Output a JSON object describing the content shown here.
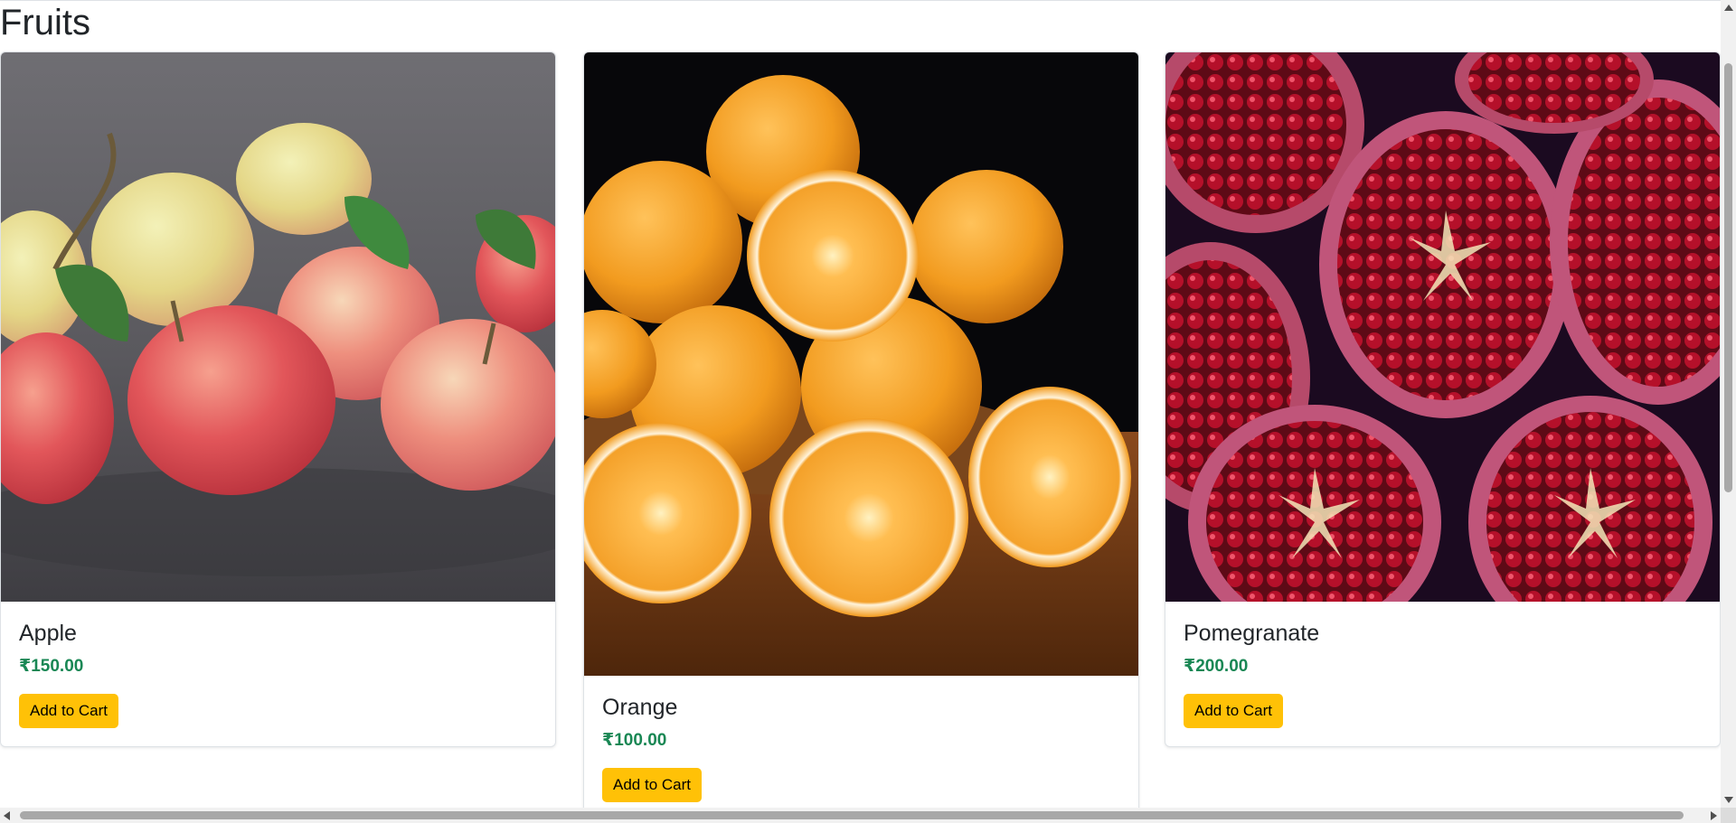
{
  "page": {
    "title": "Fruits"
  },
  "products": [
    {
      "name": "Apple",
      "price": "₹150.00",
      "button": "Add to Cart",
      "image": "apples-photo"
    },
    {
      "name": "Orange",
      "price": "₹100.00",
      "button": "Add to Cart",
      "image": "oranges-photo"
    },
    {
      "name": "Pomegranate",
      "price": "₹200.00",
      "button": "Add to Cart",
      "image": "pomegranates-photo"
    }
  ],
  "colors": {
    "price": "#198754",
    "button": "#ffc107"
  }
}
